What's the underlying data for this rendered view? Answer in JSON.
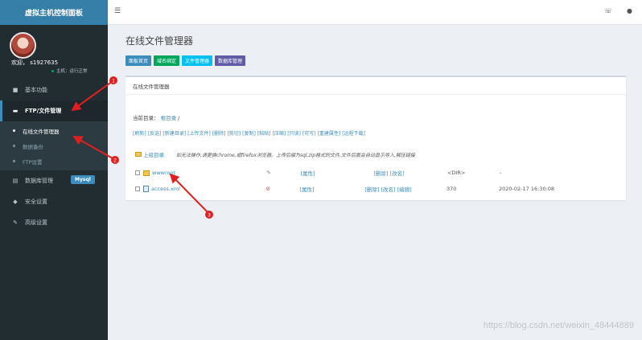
{
  "brand": "虚拟主机控制面板",
  "user": {
    "welcome": "欢迎， s1927635",
    "host_status": "主机：运行正常"
  },
  "sidebar": {
    "items": [
      {
        "label": "基本功能",
        "icon": "dashboard-icon"
      },
      {
        "label": "FTP/文件管理",
        "icon": "folder-icon"
      },
      {
        "label": "数据库管理",
        "icon": "database-icon",
        "badge": "Mysql"
      },
      {
        "label": "安全设置",
        "icon": "shield-icon"
      },
      {
        "label": "高级设置",
        "icon": "edit-icon"
      }
    ],
    "submenu": [
      {
        "label": "在线文件管理器"
      },
      {
        "label": "数据备份"
      },
      {
        "label": "FTP设置"
      }
    ]
  },
  "page": {
    "title": "在线文件管理器",
    "quick_buttons": [
      {
        "label": "面板首页",
        "color": "#3c8dbc"
      },
      {
        "label": "域名绑定",
        "color": "#00a65a"
      },
      {
        "label": "文件管理器",
        "color": "#00c0ef"
      },
      {
        "label": "数据库管理",
        "color": "#605ca8"
      }
    ],
    "box_title": "在线文件管理器",
    "current_dir_label": "当前目录：",
    "current_dir_root": "根目录",
    "current_dir_sep": "/",
    "toolbar": [
      "[刷新]",
      "[反选]",
      "[新建目录]",
      "[上传文件]",
      "[删除]",
      "[剪切]",
      "[复制]",
      "[粘贴]",
      "[压缩]",
      "[只读]",
      "[可写]",
      "[重建属性]",
      "[远程下载]"
    ],
    "up_label": "上级目录",
    "hint": "如无法操作,请更换chrome,或firefox浏览器。上传后缀为sql,zip格式的文件,文件后面会自动显示导入,解压链接",
    "files": [
      {
        "name": "wwwroot",
        "type": "folder",
        "attr": "[属性]",
        "actions": "[删除] [改名]",
        "size": "<DIR>",
        "mtime": "-"
      },
      {
        "name": "access.xml",
        "type": "file",
        "attr": "[属性]",
        "actions": "[删除] [改名] [编辑]",
        "size": "370",
        "mtime": "2020-02-17 16:30:08"
      }
    ]
  },
  "annotations": [
    "1",
    "2",
    "3"
  ],
  "watermark": "https://blog.csdn.net/weixin_48444889"
}
